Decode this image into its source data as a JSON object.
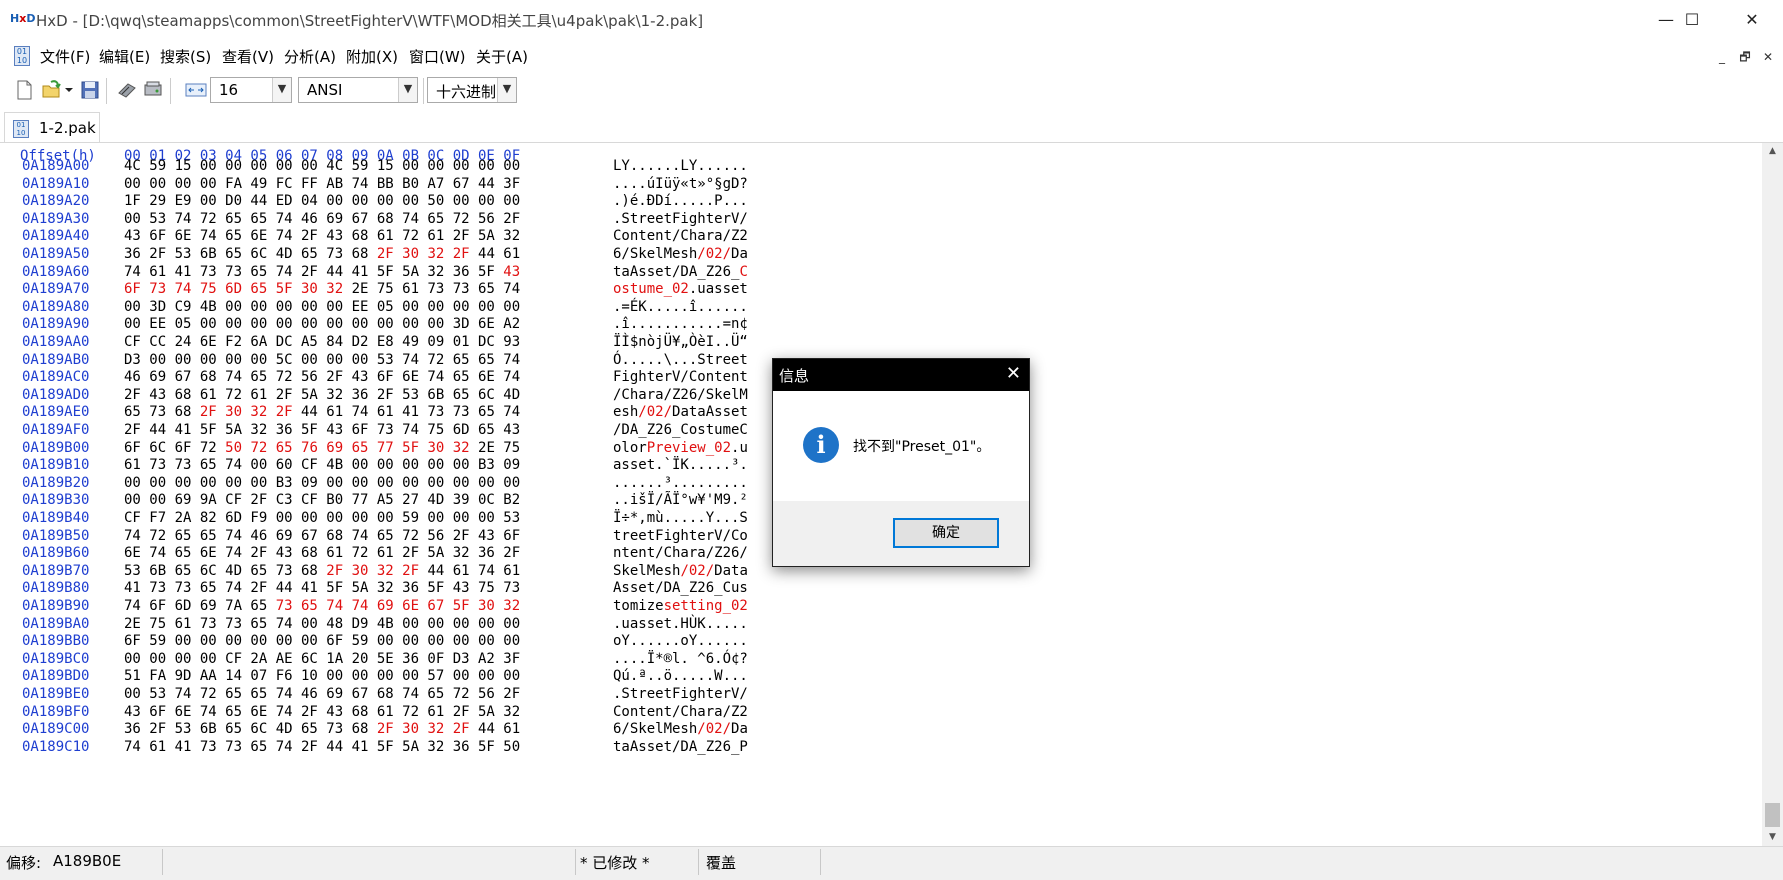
{
  "window": {
    "title": "HxD - [D:\\qwq\\steamapps\\common\\StreetFighterV\\WTF\\MOD相关工具\\u4pak\\pak\\1-2.pak]",
    "minimize": "—",
    "maximize": "☐",
    "close": "✕"
  },
  "menu": {
    "items": [
      "文件(F)",
      "编辑(E)",
      "搜索(S)",
      "查看(V)",
      "分析(A)",
      "附加(X)",
      "窗口(W)",
      "关于(A)"
    ],
    "mdi_buttons": [
      "_",
      "🗗",
      "✕"
    ]
  },
  "toolbar": {
    "bytes_per_row": "16",
    "charset": "ANSI",
    "offset_base": "十六进制"
  },
  "tab": {
    "label": "1-2.pak"
  },
  "hex": {
    "header_offset": "Offset(h)",
    "header_columns": "00 01 02 03 04 05 06 07 08 09 0A 0B 0C 0D 0E 0F",
    "rows": [
      {
        "offset": "0A189A00",
        "hex": "4C 59 15 00 00 00 00 00 4C 59 15 00 00 00 00 00",
        "ascii": "LY......LY......"
      },
      {
        "offset": "0A189A10",
        "hex": "00 00 00 00 FA 49 FC FF AB 74 BB B0 A7 67 44 3F",
        "ascii": "....úIüÿ«t»°§gD?"
      },
      {
        "offset": "0A189A20",
        "hex": "1F 29 E9 00 D0 44 ED 04 00 00 00 00 50 00 00 00",
        "ascii": ".)é.ÐDí.....P..."
      },
      {
        "offset": "0A189A30",
        "hex": "00 53 74 72 65 65 74 46 69 67 68 74 65 72 56 2F",
        "ascii": ".StreetFighterV/"
      },
      {
        "offset": "0A189A40",
        "hex": "43 6F 6E 74 65 6E 74 2F 43 68 61 72 61 2F 5A 32",
        "ascii": "Content/Chara/Z2"
      },
      {
        "offset": "0A189A50",
        "hex": "36 2F 53 6B 65 6C 4D 65 73 68 |2F 30 32 2F| 44 61",
        "ascii": "6/SkelMesh|/02/|Da"
      },
      {
        "offset": "0A189A60",
        "hex": "74 61 41 73 73 65 74 2F 44 41 5F 5A 32 36 5F |43|",
        "ascii": "taAsset/DA_Z26_|C|"
      },
      {
        "offset": "0A189A70",
        "hex": "|6F 73 74 75 6D 65 5F 30 32| 2E 75 61 73 73 65 74",
        "ascii": "|ostume_02|.uasset"
      },
      {
        "offset": "0A189A80",
        "hex": "00 3D C9 4B 00 00 00 00 00 EE 05 00 00 00 00 00",
        "ascii": ".=ÉK.....î......"
      },
      {
        "offset": "0A189A90",
        "hex": "00 EE 05 00 00 00 00 00 00 00 00 00 00 3D 6E A2",
        "ascii": ".î...........=n¢"
      },
      {
        "offset": "0A189AA0",
        "hex": "CF CC 24 6E F2 6A DC A5 84 D2 E8 49 09 01 DC 93",
        "ascii": "ÏÌ$nòjÜ¥„ÒèI..Ü“"
      },
      {
        "offset": "0A189AB0",
        "hex": "D3 00 00 00 00 00 5C 00 00 00 53 74 72 65 65 74",
        "ascii": "Ó.....\\...Street"
      },
      {
        "offset": "0A189AC0",
        "hex": "46 69 67 68 74 65 72 56 2F 43 6F 6E 74 65 6E 74",
        "ascii": "FighterV/Content"
      },
      {
        "offset": "0A189AD0",
        "hex": "2F 43 68 61 72 61 2F 5A 32 36 2F 53 6B 65 6C 4D",
        "ascii": "/Chara/Z26/SkelM"
      },
      {
        "offset": "0A189AE0",
        "hex": "65 73 68 |2F 30 32 2F| 44 61 74 61 41 73 73 65 74",
        "ascii": "esh|/02/|DataAsset"
      },
      {
        "offset": "0A189AF0",
        "hex": "2F 44 41 5F 5A 32 36 5F 43 6F 73 74 75 6D 65 43",
        "ascii": "/DA_Z26_CostumeC"
      },
      {
        "offset": "0A189B00",
        "hex": "6F 6C 6F 72 |50 72 65 76 69 65 77 5F 30 32| 2E 75",
        "ascii": "olor|Preview_02|.u"
      },
      {
        "offset": "0A189B10",
        "hex": "61 73 73 65 74 00 60 CF 4B 00 00 00 00 00 B3 09",
        "ascii": "asset.`ÏK.....³."
      },
      {
        "offset": "0A189B20",
        "hex": "00 00 00 00 00 00 B3 09 00 00 00 00 00 00 00 00",
        "ascii": "......³........."
      },
      {
        "offset": "0A189B30",
        "hex": "00 00 69 9A CF 2F C3 CF B0 77 A5 27 4D 39 0C B2",
        "ascii": "..išÏ/ÃÏ°w¥'M9.²"
      },
      {
        "offset": "0A189B40",
        "hex": "CF F7 2A 82 6D F9 00 00 00 00 00 59 00 00 00 53",
        "ascii": "Ï÷*‚mù.....Y...S"
      },
      {
        "offset": "0A189B50",
        "hex": "74 72 65 65 74 46 69 67 68 74 65 72 56 2F 43 6F",
        "ascii": "treetFighterV/Co"
      },
      {
        "offset": "0A189B60",
        "hex": "6E 74 65 6E 74 2F 43 68 61 72 61 2F 5A 32 36 2F",
        "ascii": "ntent/Chara/Z26/"
      },
      {
        "offset": "0A189B70",
        "hex": "53 6B 65 6C 4D 65 73 68 |2F 30 32 2F| 44 61 74 61",
        "ascii": "SkelMesh|/02/|Data"
      },
      {
        "offset": "0A189B80",
        "hex": "41 73 73 65 74 2F 44 41 5F 5A 32 36 5F 43 75 73",
        "ascii": "Asset/DA_Z26_Cus"
      },
      {
        "offset": "0A189B90",
        "hex": "74 6F 6D 69 7A 65 |73 65 74 74 69 6E 67 5F 30 32|",
        "ascii": "tomize|setting_02|"
      },
      {
        "offset": "0A189BA0",
        "hex": "2E 75 61 73 73 65 74 00 48 D9 4B 00 00 00 00 00",
        "ascii": ".uasset.HÙK....."
      },
      {
        "offset": "0A189BB0",
        "hex": "6F 59 00 00 00 00 00 00 6F 59 00 00 00 00 00 00",
        "ascii": "oY......oY......"
      },
      {
        "offset": "0A189BC0",
        "hex": "00 00 00 00 CF 2A AE 6C 1A 20 5E 36 0F D3 A2 3F",
        "ascii": "....Ï*®l. ^6.Ó¢?"
      },
      {
        "offset": "0A189BD0",
        "hex": "51 FA 9D AA 14 07 F6 10 00 00 00 00 57 00 00 00",
        "ascii": "Qú.ª..ö.....W..."
      },
      {
        "offset": "0A189BE0",
        "hex": "00 53 74 72 65 65 74 46 69 67 68 74 65 72 56 2F",
        "ascii": ".StreetFighterV/"
      },
      {
        "offset": "0A189BF0",
        "hex": "43 6F 6E 74 65 6E 74 2F 43 68 61 72 61 2F 5A 32",
        "ascii": "Content/Chara/Z2"
      },
      {
        "offset": "0A189C00",
        "hex": "36 2F 53 6B 65 6C 4D 65 73 68 |2F 30 32 2F| 44 61",
        "ascii": "6/SkelMesh|/02/|Da"
      },
      {
        "offset": "0A189C10",
        "hex": "74 61 41 73 73 65 74 2F 44 41 5F 5A 32 36 5F 50",
        "ascii": "taAsset/DA_Z26_P"
      }
    ]
  },
  "status": {
    "offset_label": "偏移:",
    "offset_value": "A189B0E",
    "modified": "* 已修改 *",
    "mode": "覆盖"
  },
  "dialog": {
    "title": "信息",
    "close": "✕",
    "icon": "i",
    "message": "找不到\"Preset_01\"。",
    "ok_label": "确定"
  },
  "colors": {
    "offset_blue": "#1e3ed0",
    "highlight_red": "#e01010",
    "dialog_title_bg": "#000000",
    "info_icon_blue": "#1e73c8",
    "ok_border": "#0078d7"
  },
  "icons": [
    "hxd-app-icon",
    "new-file-icon",
    "open-file-icon",
    "save-icon",
    "ram-icon",
    "disk-icon",
    "columns-icon",
    "info-icon"
  ]
}
